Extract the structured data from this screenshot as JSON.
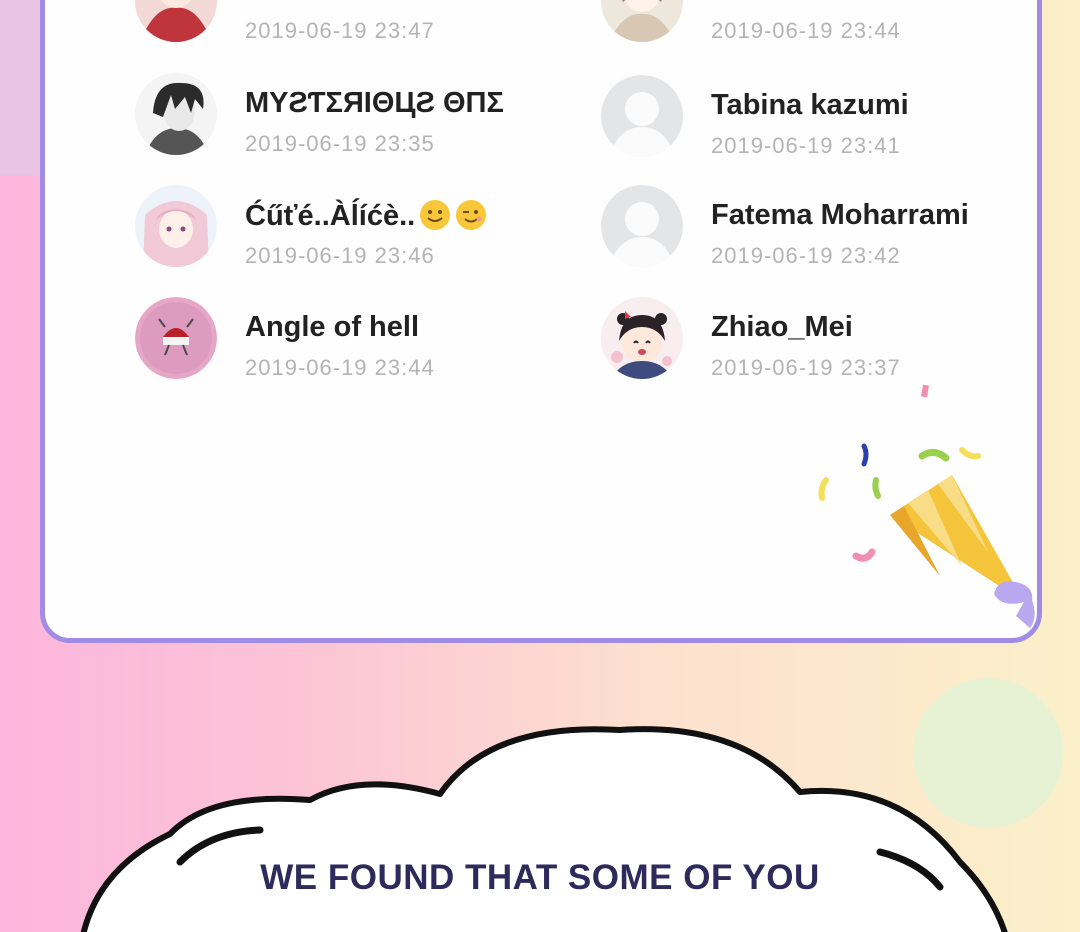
{
  "members": [
    {
      "name": "",
      "time": "2019-06-19  23:47",
      "avatar": "anime-red-avatar"
    },
    {
      "name": "",
      "time": "2019-06-19  23:44",
      "avatar": "anime-light-avatar"
    },
    {
      "name": "ΜΥƧƬΣЯΙΘЦƧ ΘΠΣ",
      "time": "2019-06-19  23:35",
      "avatar": "anime-dark-hair-avatar"
    },
    {
      "name": "Tabina kazumi",
      "time": "2019-06-19  23:41",
      "avatar": "default-avatar"
    },
    {
      "name": "Ćűťé..Àĺíćè..",
      "time": "2019-06-19  23:46",
      "avatar": "anime-pink-hair-avatar"
    },
    {
      "name": "Fatema Moharrami",
      "time": "2019-06-19  23:42",
      "avatar": "default-avatar"
    },
    {
      "name": "Angle of hell",
      "time": "2019-06-19  23:44",
      "avatar": "pink-emblem-avatar"
    },
    {
      "name": "Zhiao_Mei",
      "time": "2019-06-19  23:37",
      "avatar": "anime-girl-avatar"
    }
  ],
  "emojis": [
    "smiling-face-icon",
    "winking-face-icon"
  ],
  "decorations": [
    "party-popper-icon",
    "confetti-icon",
    "speech-cloud"
  ],
  "banner": {
    "text": "WE FOUND THAT SOME OF YOU"
  },
  "colors": {
    "card_border": "#a08ce4",
    "name": "#222222",
    "time": "#b4b4b4",
    "banner_text": "#2e2a5c",
    "popper": "#f4c53a"
  }
}
